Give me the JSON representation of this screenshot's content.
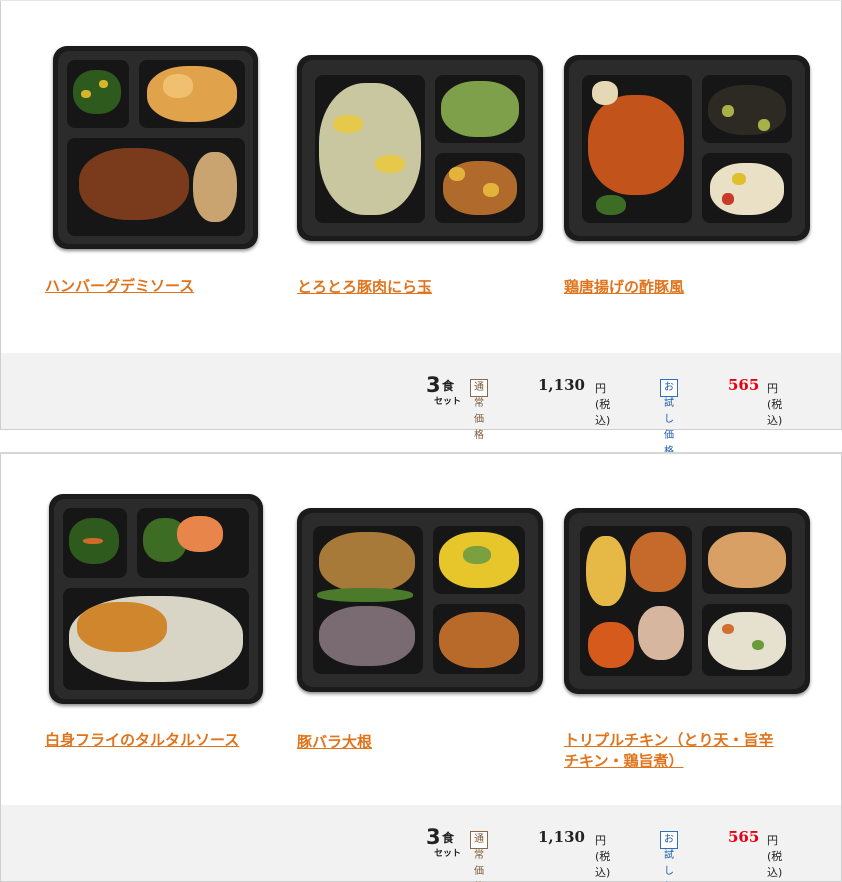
{
  "sets": [
    {
      "items": [
        {
          "name": "ハンバーグデミソース"
        },
        {
          "name": "とろとろ豚肉にら玉"
        },
        {
          "name": "鶏唐揚げの酢豚風"
        }
      ],
      "price": {
        "set_num": "3",
        "set_shoku": "食",
        "set_label": "セット",
        "normal_tag": "通常価格",
        "normal_price": "1,130",
        "normal_unit": "円(税込)",
        "trial_tag": "お試し価格",
        "trial_price": "565",
        "trial_unit": "円(税込)"
      }
    },
    {
      "items": [
        {
          "name": "白身フライのタルタルソース"
        },
        {
          "name": "豚バラ大根"
        },
        {
          "name": "トリプルチキン（とり天・旨辛チキン・鶏旨煮）"
        }
      ],
      "price": {
        "set_num": "3",
        "set_shoku": "食",
        "set_label": "セット",
        "normal_tag": "通常価格",
        "normal_price": "1,130",
        "normal_unit": "円(税込)",
        "trial_tag": "お試し価格",
        "trial_price": "565",
        "trial_unit": "円(税込)"
      }
    }
  ],
  "colors": {
    "link": "#e0741c",
    "trial_price": "#e60012",
    "price_bar": "#f2f2f2"
  }
}
